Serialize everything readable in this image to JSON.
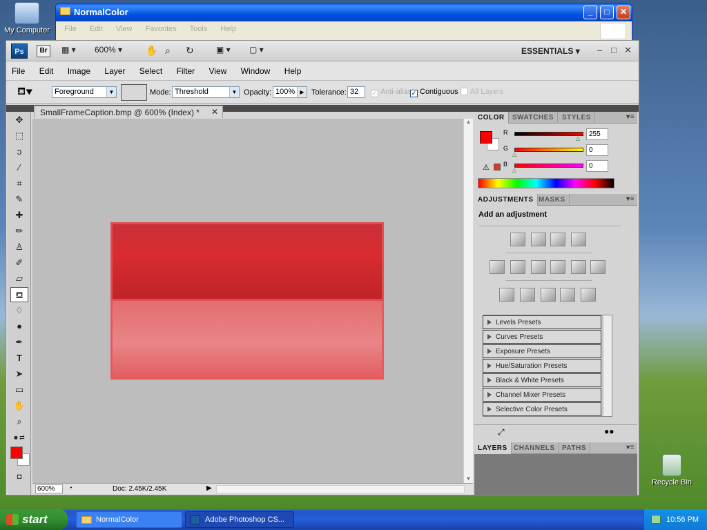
{
  "desktop": {
    "my_computer_label": "My Computer",
    "recycle_bin_label": "Recycle Bin"
  },
  "explorer": {
    "title": "NormalColor",
    "menu": [
      "File",
      "Edit",
      "View",
      "Favorites",
      "Tools",
      "Help"
    ]
  },
  "photoshop": {
    "ps_logo": "Ps",
    "br_logo": "Br",
    "zoom_dropdown": "600%",
    "workspace": "ESSENTIALS",
    "menu": [
      "File",
      "Edit",
      "Image",
      "Layer",
      "Select",
      "Filter",
      "View",
      "Window",
      "Help"
    ],
    "options": {
      "fill_source": "Foreground",
      "mode_label": "Mode:",
      "mode_value": "Threshold",
      "opacity_label": "Opacity:",
      "opacity_value": "100%",
      "tolerance_label": "Tolerance:",
      "tolerance_value": "32",
      "anti_alias_label": "Anti-alias",
      "contiguous_label": "Contiguous",
      "all_layers_label": "All Layers"
    },
    "document": {
      "tab_title": "SmallFrameCaption.bmp @ 600% (Index) *",
      "zoom": "600%",
      "doc_size": "Doc: 2.45K/2.45K"
    },
    "color_panel": {
      "tabs": [
        "COLOR",
        "SWATCHES",
        "STYLES"
      ],
      "channels": [
        {
          "label": "R",
          "value": "255",
          "level": 1.0
        },
        {
          "label": "G",
          "value": "0",
          "level": 0.0
        },
        {
          "label": "B",
          "value": "0",
          "level": 0.0
        }
      ],
      "foreground": "#ff0000",
      "background": "#ffffff"
    },
    "adjustments_panel": {
      "tabs": [
        "ADJUSTMENTS",
        "MASKS"
      ],
      "heading": "Add an adjustment",
      "presets": [
        "Levels Presets",
        "Curves Presets",
        "Exposure Presets",
        "Hue/Saturation Presets",
        "Black & White Presets",
        "Channel Mixer Presets",
        "Selective Color Presets"
      ]
    },
    "layers_panel": {
      "tabs": [
        "LAYERS",
        "CHANNELS",
        "PATHS"
      ]
    }
  },
  "taskbar": {
    "start_label": "start",
    "tasks": [
      "NormalColor",
      "Adobe Photoshop CS..."
    ],
    "clock": "10:56 PM"
  }
}
